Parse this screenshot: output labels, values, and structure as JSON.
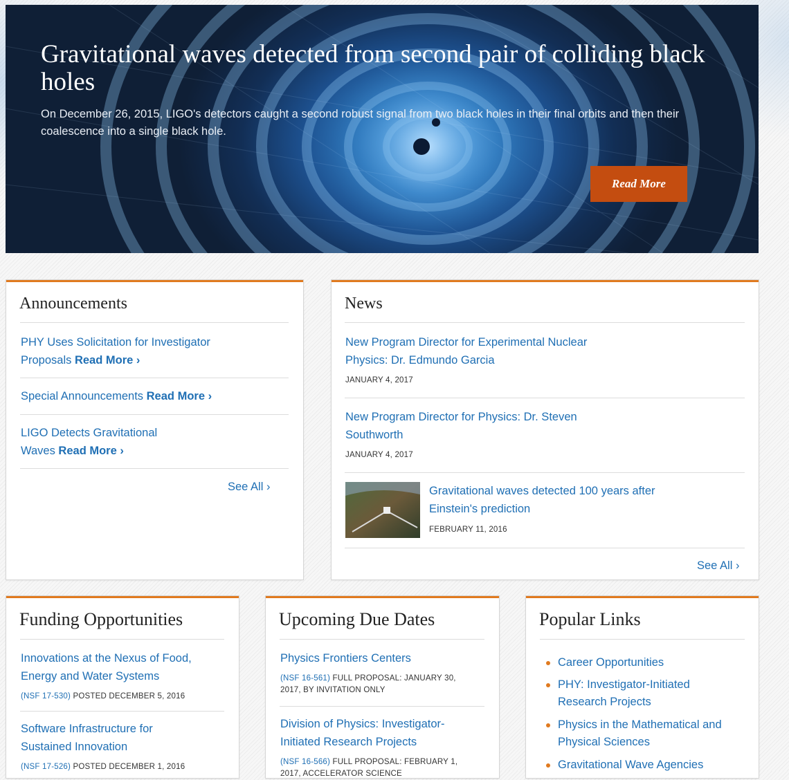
{
  "hero": {
    "title": "Gravitational waves detected from second pair of colliding black holes",
    "text": "On December 26, 2015, LIGO's detectors caught a second robust signal from two black holes in their final orbits and then their coalescence into a single black hole.",
    "button": "Read More"
  },
  "announcements": {
    "title": "Announcements",
    "items": [
      {
        "line1": "PHY Uses Solicitation for Investigator",
        "line2": "Proposals",
        "more": "Read More ›"
      },
      {
        "line1": "Special Announcements",
        "more": "Read More ›"
      },
      {
        "line1": "LIGO Detects Gravitational",
        "line2": "Waves",
        "more": "Read More ›"
      }
    ],
    "see_all": "See All ›"
  },
  "news": {
    "title": "News",
    "items": [
      {
        "line1": "New Program Director for Experimental Nuclear",
        "line2": "Physics: Dr. Edmundo Garcia",
        "date": "JANUARY 4, 2017"
      },
      {
        "line1": "New Program Director for Physics: Dr. Steven",
        "line2": "Southworth",
        "date": "JANUARY 4, 2017"
      },
      {
        "line1": "Gravitational waves detected 100 years after",
        "line2": "Einstein's prediction",
        "date": "FEBRUARY 11, 2016"
      }
    ],
    "see_all": "See All ›"
  },
  "funding": {
    "title": "Funding Opportunities",
    "items": [
      {
        "line1": "Innovations at the Nexus of Food,",
        "line2": "Energy and Water Systems",
        "sol": "(NSF 17-530)",
        "date": "POSTED DECEMBER 5, 2016"
      },
      {
        "line1": "Software Infrastructure for",
        "line2": "Sustained Innovation",
        "sol": "(NSF 17-526)",
        "date": "POSTED DECEMBER 1, 2016"
      }
    ]
  },
  "due_dates": {
    "title": "Upcoming Due Dates",
    "items": [
      {
        "line1": "Physics Frontiers Centers",
        "sol": "(NSF 16-561)",
        "date1": "FULL PROPOSAL: JANUARY 30,",
        "date2": "2017, BY INVITATION ONLY"
      },
      {
        "line1": "Division of Physics: Investigator-",
        "line2": "Initiated Research Projects",
        "sol": "(NSF 16-566)",
        "date1": "FULL PROPOSAL: FEBRUARY 1,",
        "date2": "2017, ACCELERATOR SCIENCE"
      }
    ]
  },
  "popular": {
    "title": "Popular Links",
    "items": [
      {
        "line1": "Career Opportunities"
      },
      {
        "line1": "PHY: Investigator-Initiated",
        "line2": "Research Projects"
      },
      {
        "line1": "Physics in the Mathematical and",
        "line2": "Physical Sciences"
      },
      {
        "line1": "Gravitational Wave Agencies"
      }
    ]
  },
  "colors": {
    "accent": "#e07a1f",
    "link": "#1f6fb4",
    "button": "#c44d10"
  }
}
